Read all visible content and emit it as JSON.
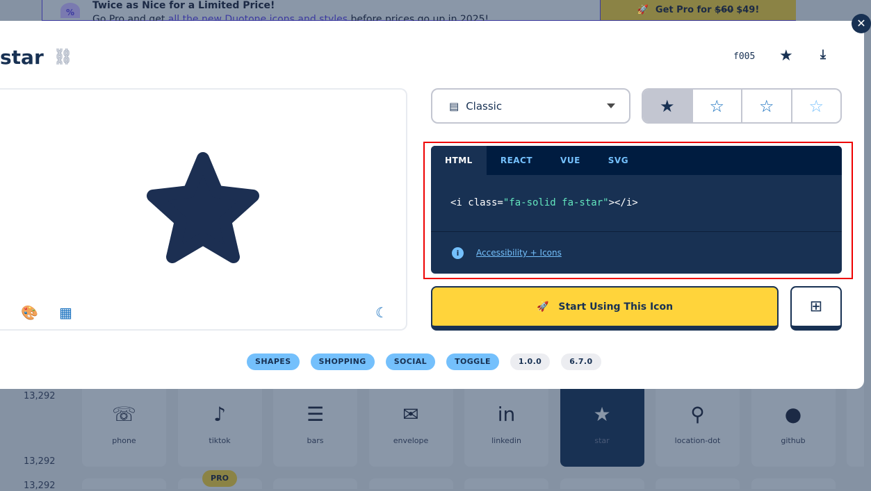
{
  "banner": {
    "title": "Twice as Nice for a Limited Price!",
    "subtitle_pre": "Go Pro and get ",
    "subtitle_link": "all the new Duotone icons and styles",
    "subtitle_post": " before prices go up in 2025!",
    "button_prefix": "Get Pro for",
    "old_price": "$60",
    "new_price": "$49!"
  },
  "modal": {
    "title": "star",
    "unicode": "f005",
    "style_select": "Classic",
    "styles": [
      "solid",
      "regular",
      "light",
      "thin"
    ],
    "code_tabs": [
      "HTML",
      "REACT",
      "VUE",
      "SVG"
    ],
    "active_tab": "HTML",
    "snippet": {
      "pre": "<i class=",
      "str": "\"fa-solid fa-star\"",
      "post": "></i>"
    },
    "a11y_link": "Accessibility + Icons",
    "start_button": "Start Using This Icon",
    "tags": [
      "SHAPES",
      "SHOPPING",
      "SOCIAL",
      "TOGGLE"
    ],
    "versions": [
      "1.0.0",
      "6.7.0"
    ]
  },
  "background": {
    "counts": [
      "13,292",
      "13,292",
      "13,292"
    ],
    "tiles": [
      {
        "label": "phone",
        "icon": "☏"
      },
      {
        "label": "tiktok",
        "icon": "♪"
      },
      {
        "label": "bars",
        "icon": "☰"
      },
      {
        "label": "envelope",
        "icon": "✉"
      },
      {
        "label": "linkedin",
        "icon": "in"
      },
      {
        "label": "star",
        "icon": "★"
      },
      {
        "label": "location-dot",
        "icon": "⚲"
      },
      {
        "label": "github",
        "icon": "●"
      }
    ],
    "pro_badge": "PRO"
  },
  "colors": {
    "navy": "#183153",
    "yellow": "#ffd43b",
    "blue": "#146ebe",
    "highlight": "#ee0000"
  }
}
